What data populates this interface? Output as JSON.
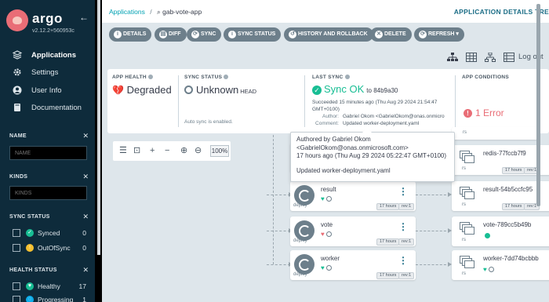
{
  "sidebar": {
    "logo": "argo",
    "version": "v2.12.2+560953c",
    "nav": [
      {
        "label": "Applications",
        "icon": "layers-icon"
      },
      {
        "label": "Settings",
        "icon": "gear-icon"
      },
      {
        "label": "User Info",
        "icon": "user-icon"
      },
      {
        "label": "Documentation",
        "icon": "book-icon"
      }
    ],
    "filters": {
      "name": {
        "title": "NAME",
        "placeholder": "NAME"
      },
      "kinds": {
        "title": "KINDS",
        "placeholder": "KINDS"
      },
      "sync_status": {
        "title": "SYNC STATUS",
        "items": [
          {
            "label": "Synced",
            "count": "0",
            "color": "#18be94"
          },
          {
            "label": "OutOfSync",
            "count": "0",
            "color": "#f4c030"
          }
        ]
      },
      "health_status": {
        "title": "HEALTH STATUS",
        "items": [
          {
            "label": "Healthy",
            "count": "17",
            "color": "#18be94"
          },
          {
            "label": "Progressing",
            "count": "1",
            "color": "#0dadea"
          }
        ]
      }
    }
  },
  "topbar": {
    "breadcrumb_root": "Applications",
    "breadcrumb_sep": "/",
    "app_name": "gab-vote-app",
    "page_title": "APPLICATION DETAILS TREE"
  },
  "toolbar": {
    "buttons": [
      "DETAILS",
      "DIFF",
      "SYNC",
      "SYNC STATUS",
      "HISTORY AND ROLLBACK",
      "DELETE",
      "REFRESH"
    ],
    "logout": "Log out"
  },
  "status": {
    "app_health": {
      "title": "APP HEALTH",
      "value": "Degraded"
    },
    "sync_status": {
      "title": "SYNC STATUS",
      "value": "Unknown",
      "ref": "HEAD",
      "note": "Auto sync is enabled."
    },
    "last_sync": {
      "title": "LAST SYNC",
      "value": "Sync OK",
      "to": "to 84b9a30",
      "succeeded": "Succeeded 15 minutes ago (Thu Aug 29 2024 21:54:47",
      "succeeded_tz": "GMT+0100)",
      "author_label": "Author:",
      "author": "Gabriel Okom <GabrielOkom@onas.onmicro",
      "comment_label": "Comment:",
      "comment": "Updated worker-deployment.yaml"
    },
    "app_conditions": {
      "title": "APP CONDITIONS",
      "value": "1 Error"
    }
  },
  "zoom": {
    "value": "100%"
  },
  "tooltip": {
    "line1": "Authored by Gabriel Okom",
    "line2": "<GabrielOkom@onas.onmicrosoft.com>",
    "line3": "17 hours ago (Thu Aug 29 2024 05:22:47 GMT+0100)",
    "line4": "Updated worker-deployment.yaml"
  },
  "graph": {
    "deployments": [
      {
        "name": "result",
        "type": "deploy",
        "age": "17 hours",
        "rev": "rev:1",
        "health": "healthy"
      },
      {
        "name": "vote",
        "type": "deploy",
        "age": "17 hours",
        "rev": "rev:1",
        "health": "degraded"
      },
      {
        "name": "worker",
        "type": "deploy",
        "age": "17 hours",
        "rev": "rev:1",
        "health": "healthy"
      }
    ],
    "replicasets": [
      {
        "name": "redis-77fccb7f9",
        "type": "rs",
        "age": "17 hours",
        "rev": "rev:1"
      },
      {
        "name": "result-54b5ccfc95",
        "type": "rs",
        "age": "17 hours",
        "rev": "rev:1"
      },
      {
        "name": "vote-789cc5b49b",
        "type": "rs",
        "age": "",
        "rev": ""
      },
      {
        "name": "worker-7dd74bcbbb",
        "type": "rs",
        "age": "",
        "rev": ""
      }
    ],
    "partial_rs_type": "rs"
  }
}
